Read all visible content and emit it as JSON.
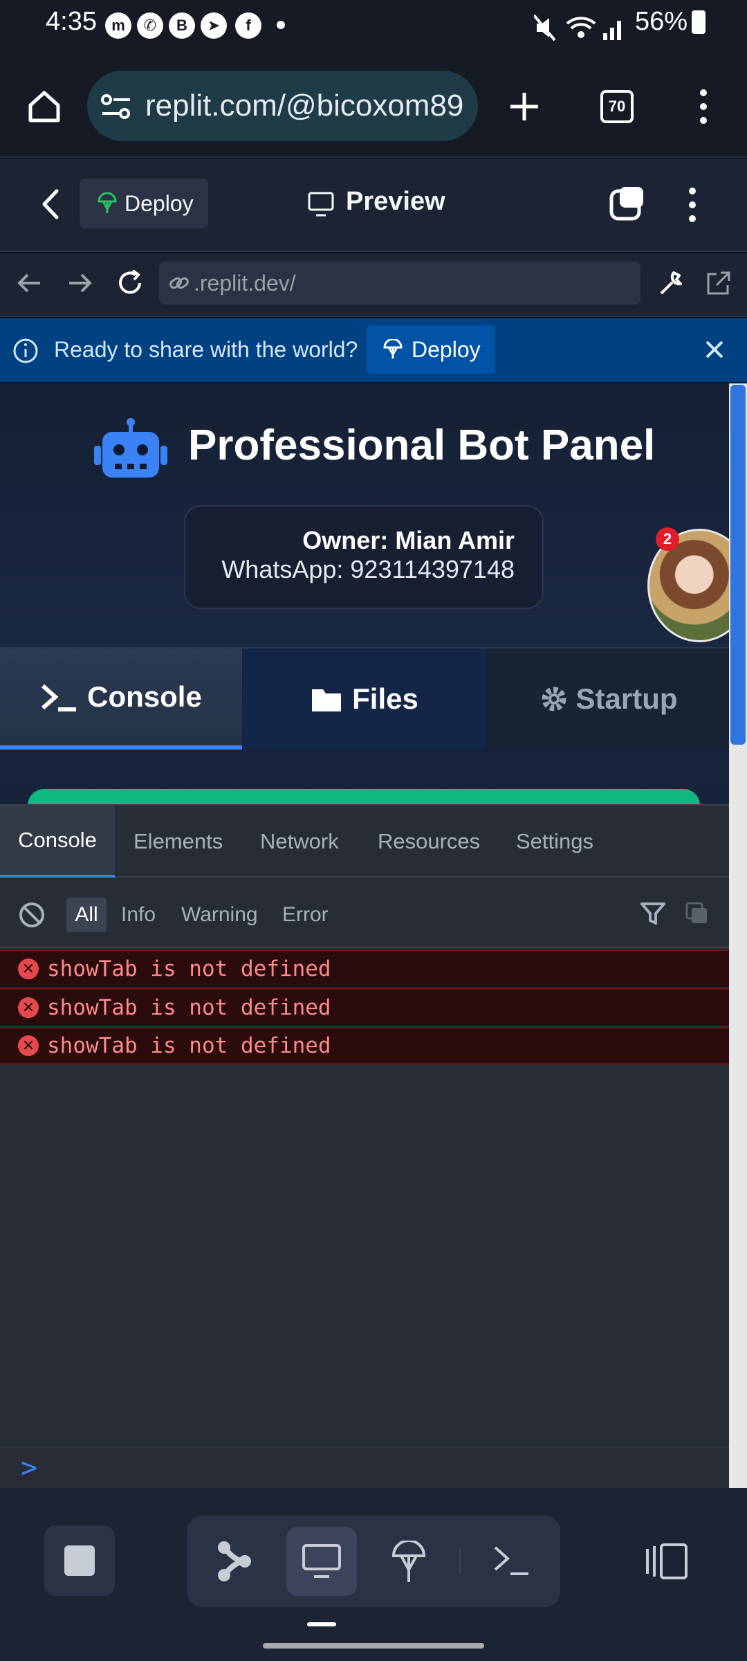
{
  "status_bar": {
    "time": "4:35",
    "battery": "56%",
    "notification_icons": [
      "messenger-icon",
      "whatsapp-icon",
      "whatsapp-business-icon",
      "telegram-icon",
      "facebook-icon"
    ]
  },
  "browser": {
    "url": "replit.com/@bicoxom89",
    "tab_count": "70"
  },
  "replit_header": {
    "deploy_label": "Deploy",
    "preview_title": "Preview"
  },
  "webview": {
    "address": ".replit.dev/"
  },
  "banner": {
    "text": "Ready to share with the world?",
    "deploy_label": "Deploy"
  },
  "app": {
    "title": "Professional Bot Panel",
    "owner": "Owner: Mian Amir",
    "whatsapp": "WhatsApp: 923114397148",
    "avatar_badge": "2",
    "tabs": [
      {
        "label": "Console",
        "icon": "terminal-icon"
      },
      {
        "label": "Files",
        "icon": "folder-icon"
      },
      {
        "label": "Startup",
        "icon": "gear-icon"
      }
    ]
  },
  "devtools": {
    "tabs": [
      "Console",
      "Elements",
      "Network",
      "Resources",
      "Settings"
    ],
    "filters": [
      "All",
      "Info",
      "Warning",
      "Error"
    ],
    "logs": [
      "showTab is not defined",
      "showTab is not defined",
      "showTab is not defined"
    ],
    "prompt": ">"
  },
  "colors": {
    "accent": "#3b82f6",
    "error_bg": "#2b0b0b",
    "error_text": "#ff8a8a",
    "banner": "#004182",
    "success": "#10b981"
  }
}
